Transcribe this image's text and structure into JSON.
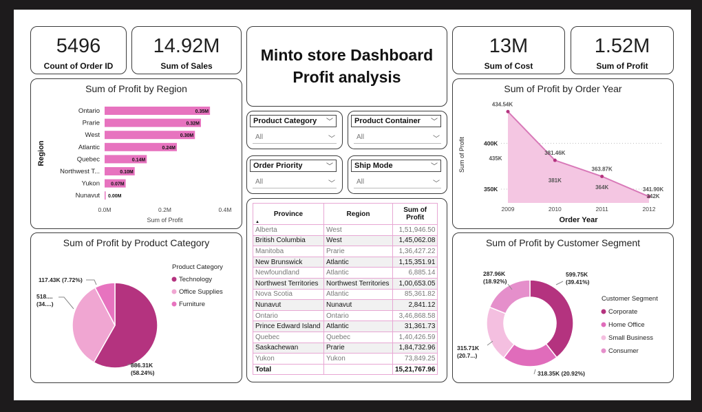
{
  "kpis": {
    "orders": {
      "value": "5496",
      "label": "Count of Order ID"
    },
    "sales": {
      "value": "14.92M",
      "label": "Sum of Sales"
    },
    "cost": {
      "value": "13M",
      "label": "Sum of Cost"
    },
    "profit": {
      "value": "1.52M",
      "label": "Sum of Profit"
    }
  },
  "title": {
    "line1": "Minto store Dashboard",
    "line2": "Profit analysis"
  },
  "slicers": [
    {
      "label": "Product Category",
      "value": "All"
    },
    {
      "label": "Product Container",
      "value": "All"
    },
    {
      "label": "Order Priority",
      "value": "All"
    },
    {
      "label": "Ship Mode",
      "value": "All"
    }
  ],
  "table": {
    "headers": [
      "Province",
      "Region",
      "Sum of Profit"
    ],
    "sort_indicator": "▲",
    "rows": [
      [
        "Alberta",
        "West",
        "1,51,946.50"
      ],
      [
        "British Columbia",
        "West",
        "1,45,062.08"
      ],
      [
        "Manitoba",
        "Prarie",
        "1,36,427.22"
      ],
      [
        "New Brunswick",
        "Atlantic",
        "1,15,351.91"
      ],
      [
        "Newfoundland",
        "Atlantic",
        "6,885.14"
      ],
      [
        "Northwest Territories",
        "Northwest Territories",
        "1,00,653.05"
      ],
      [
        "Nova Scotia",
        "Atlantic",
        "85,361.82"
      ],
      [
        "Nunavut",
        "Nunavut",
        "2,841.12"
      ],
      [
        "Ontario",
        "Ontario",
        "3,46,868.58"
      ],
      [
        "Prince Edward Island",
        "Atlantic",
        "31,361.73"
      ],
      [
        "Quebec",
        "Quebec",
        "1,40,426.59"
      ],
      [
        "Saskachewan",
        "Prarie",
        "1,84,732.96"
      ],
      [
        "Yukon",
        "Yukon",
        "73,849.25"
      ]
    ],
    "total": [
      "Total",
      "",
      "15,21,767.96"
    ]
  },
  "colors": {
    "pink": "#e773bf",
    "magenta": "#b4337f",
    "light_pink": "#f0a6d2",
    "area": "#f4c6e2"
  },
  "chart_data": [
    {
      "type": "bar",
      "title": "Sum of Profit by Region",
      "xlabel": "Sum of Profit",
      "ylabel": "Region",
      "categories": [
        "Ontario",
        "Prarie",
        "West",
        "Atlantic",
        "Quebec",
        "Northwest T...",
        "Yukon",
        "Nunavut"
      ],
      "values": [
        0.35,
        0.32,
        0.3,
        0.24,
        0.14,
        0.1,
        0.07,
        0.0
      ],
      "data_labels": [
        "0.35M",
        "0.32M",
        "0.30M",
        "0.24M",
        "0.14M",
        "0.10M",
        "0.07M",
        "0.00M"
      ],
      "ticks": [
        "0.0M",
        "0.2M",
        "0.4M"
      ],
      "xlim": [
        0,
        0.4
      ],
      "orientation": "horizontal"
    },
    {
      "type": "area",
      "title": "Sum of Profit by Order Year",
      "xlabel": "Order Year",
      "ylabel": "Sum of Profit",
      "x": [
        2009,
        2010,
        2011,
        2012
      ],
      "values": [
        434.54,
        381.46,
        363.87,
        341.9
      ],
      "point_labels": [
        "434.54K",
        "381.46K",
        "363.87K",
        "341.90K"
      ],
      "extra_labels": [
        "435K",
        "381K",
        "364K",
        "342K"
      ],
      "yticks": [
        "350K",
        "400K"
      ],
      "ytick_values": [
        350,
        400
      ],
      "ylim": [
        335,
        440
      ],
      "grid": true
    },
    {
      "type": "pie",
      "title": "Sum of Profit by Product Category",
      "legend_title": "Product Category",
      "labels": [
        "Technology",
        "Office Supplies",
        "Furniture"
      ],
      "values": [
        886.31,
        518.0,
        117.43
      ],
      "slice_labels": [
        "886.31K\n(58.24%)",
        "518....\n(34....)",
        "117.43K (7.72%)"
      ],
      "colors": [
        "#b4337f",
        "#f0a6d2",
        "#e773bf"
      ],
      "legend_position": "right"
    },
    {
      "type": "pie",
      "donut": true,
      "title": "Sum of Profit by Customer Segment",
      "legend_title": "Customer Segment",
      "labels": [
        "Corporate",
        "Home Office",
        "Small Business",
        "Consumer"
      ],
      "values": [
        599.75,
        318.35,
        315.71,
        287.96
      ],
      "slice_labels": [
        "599.75K\n(39.41%)",
        "318.35K (20.92%)",
        "315.71K\n(20.7...)",
        "287.96K\n(18.92%)"
      ],
      "colors": [
        "#b4337f",
        "#e06cbb",
        "#f4bfe0",
        "#e58fcb"
      ],
      "legend_position": "right"
    }
  ]
}
